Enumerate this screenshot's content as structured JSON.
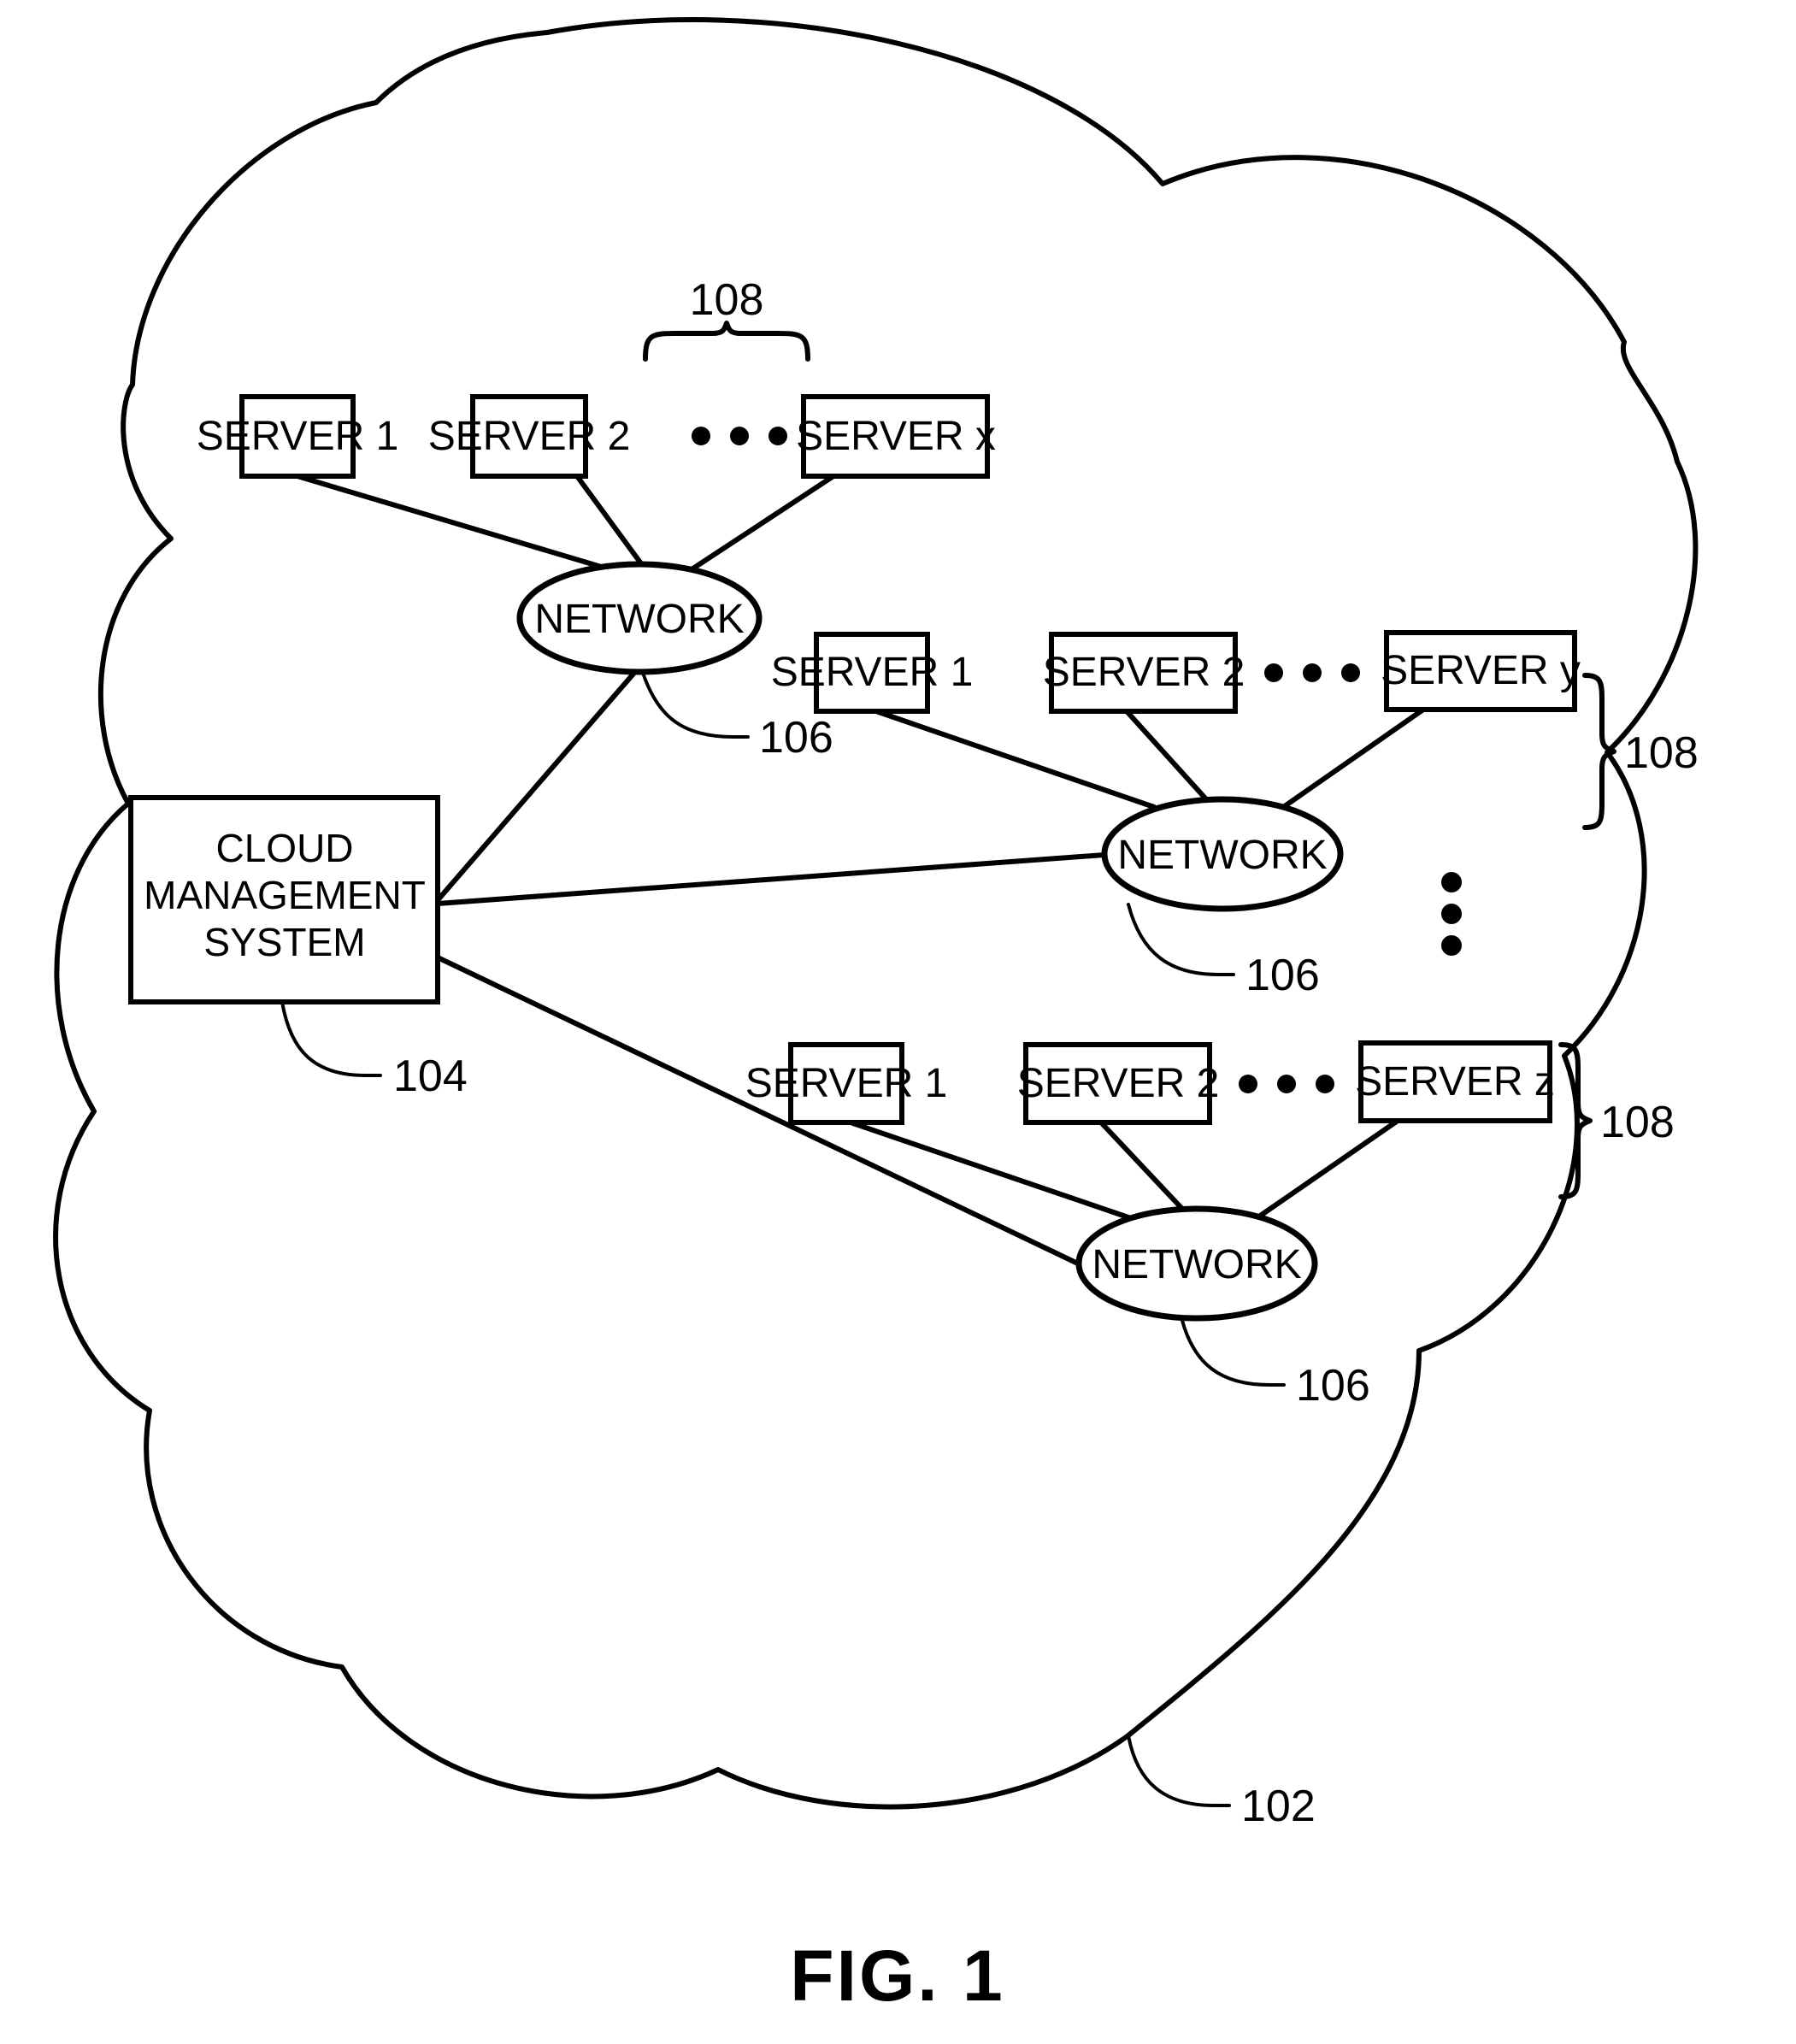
{
  "figure": {
    "caption": "FIG. 1",
    "cloud_label": "102",
    "title": "Cloud computing environment block diagram"
  },
  "management": {
    "label_line1": "CLOUD",
    "label_line2": "MANAGEMENT",
    "label_line3": "SYSTEM",
    "ref": "104"
  },
  "ellipsis": {
    "horizontal": "• • •",
    "vertical": "⋮"
  },
  "groups": [
    {
      "id": "group-top",
      "brace_ref": "108",
      "brace_orientation": "horizontal",
      "network": {
        "label": "NETWORK",
        "ref": "106"
      },
      "servers": [
        {
          "label": "SERVER 1"
        },
        {
          "label": "SERVER 2"
        },
        {
          "label": "SERVER x"
        }
      ]
    },
    {
      "id": "group-middle",
      "brace_ref": "108",
      "brace_orientation": "vertical",
      "network": {
        "label": "NETWORK",
        "ref": "106"
      },
      "servers": [
        {
          "label": "SERVER 1"
        },
        {
          "label": "SERVER 2"
        },
        {
          "label": "SERVER y"
        }
      ]
    },
    {
      "id": "group-bottom",
      "brace_ref": "108",
      "brace_orientation": "vertical",
      "network": {
        "label": "NETWORK",
        "ref": "106"
      },
      "servers": [
        {
          "label": "SERVER 1"
        },
        {
          "label": "SERVER 2"
        },
        {
          "label": "SERVER z"
        }
      ]
    }
  ],
  "colors": {
    "ink": "#000000",
    "paper": "#ffffff"
  }
}
